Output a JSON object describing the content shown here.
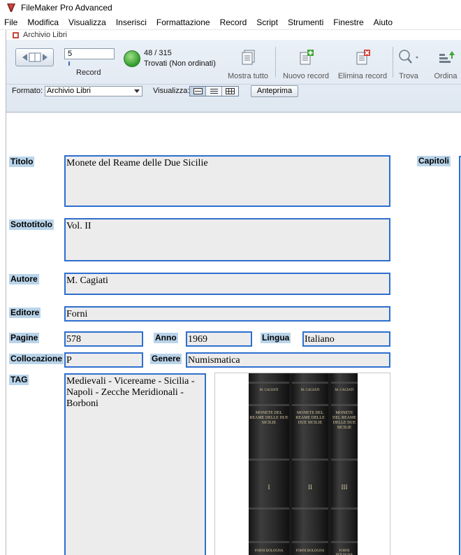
{
  "app": {
    "title": "FileMaker Pro Advanced",
    "icon": "filemaker-app-icon"
  },
  "menu": [
    "File",
    "Modifica",
    "Visualizza",
    "Inserisci",
    "Formattazione",
    "Record",
    "Script",
    "Strumenti",
    "Finestre",
    "Aiuto"
  ],
  "window": {
    "title": "Archivio Libri"
  },
  "toolbar": {
    "record_number": "5",
    "record_label": "Record",
    "found_count": "48 / 315",
    "found_status": "Trovati (Non ordinati)",
    "show_all": "Mostra tutto",
    "new_record": "Nuovo record",
    "delete_record": "Elimina record",
    "find": "Trova",
    "sort": "Ordina"
  },
  "layoutbar": {
    "format_label": "Formato:",
    "layout_name": "Archivio Libri",
    "view_label": "Visualizza:",
    "preview_button": "Anteprima"
  },
  "record": {
    "labels": {
      "title": "Titolo",
      "subtitle": "Sottotitolo",
      "author": "Autore",
      "publisher": "Editore",
      "pages": "Pagine",
      "year": "Anno",
      "language": "Lingua",
      "location": "Collocazione",
      "genre": "Genere",
      "tag": "TAG",
      "chapters": "Capitoli"
    },
    "values": {
      "title": "Monete del Reame delle Due Sicilie",
      "subtitle": "Vol. II",
      "author": "M. Cagiati",
      "publisher": "Forni",
      "pages": "578",
      "year": "1969",
      "language": "Italiano",
      "location": "P",
      "genre": "Numismatica",
      "tag": "Medievali - Vicereame - Sicilia - Napoli - Zecche Meridionali - Borboni"
    },
    "cover_image": {
      "volumes": [
        {
          "top": "M. CAGIATI",
          "title": "MONETE DEL REAME DELLE DUE SICILIE",
          "volume": "I",
          "bottom": "FORNI BOLOGNA"
        },
        {
          "top": "M. CAGIATI",
          "title": "MONETE DEL REAME DELLE DUE SICILIE",
          "volume": "II",
          "bottom": "FORNI BOLOGNA"
        },
        {
          "top": "M. CAGIATI",
          "title": "MONETE DEL REAME DELLE DUE SICILIE",
          "volume": "III",
          "bottom": "FORNI BOLOGNA"
        }
      ]
    }
  },
  "colors": {
    "field_border": "#2e6fcf",
    "label_bg": "#b9d4ea",
    "field_bg": "#ececec"
  }
}
